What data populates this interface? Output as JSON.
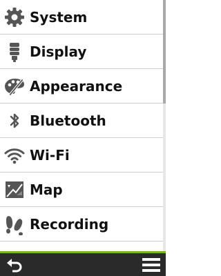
{
  "settings_menu": {
    "items": [
      {
        "label": "System",
        "icon": "gear-icon"
      },
      {
        "label": "Display",
        "icon": "light-bulb-icon"
      },
      {
        "label": "Appearance",
        "icon": "palette-icon"
      },
      {
        "label": "Bluetooth",
        "icon": "bluetooth-icon"
      },
      {
        "label": "Wi-Fi",
        "icon": "wifi-icon"
      },
      {
        "label": "Map",
        "icon": "map-icon"
      },
      {
        "label": "Recording",
        "icon": "footprints-icon"
      }
    ]
  },
  "bottom_bar": {
    "back_icon": "back-arrow-icon",
    "menu_icon": "hamburger-menu-icon",
    "accent_color": "#7ab51d"
  }
}
